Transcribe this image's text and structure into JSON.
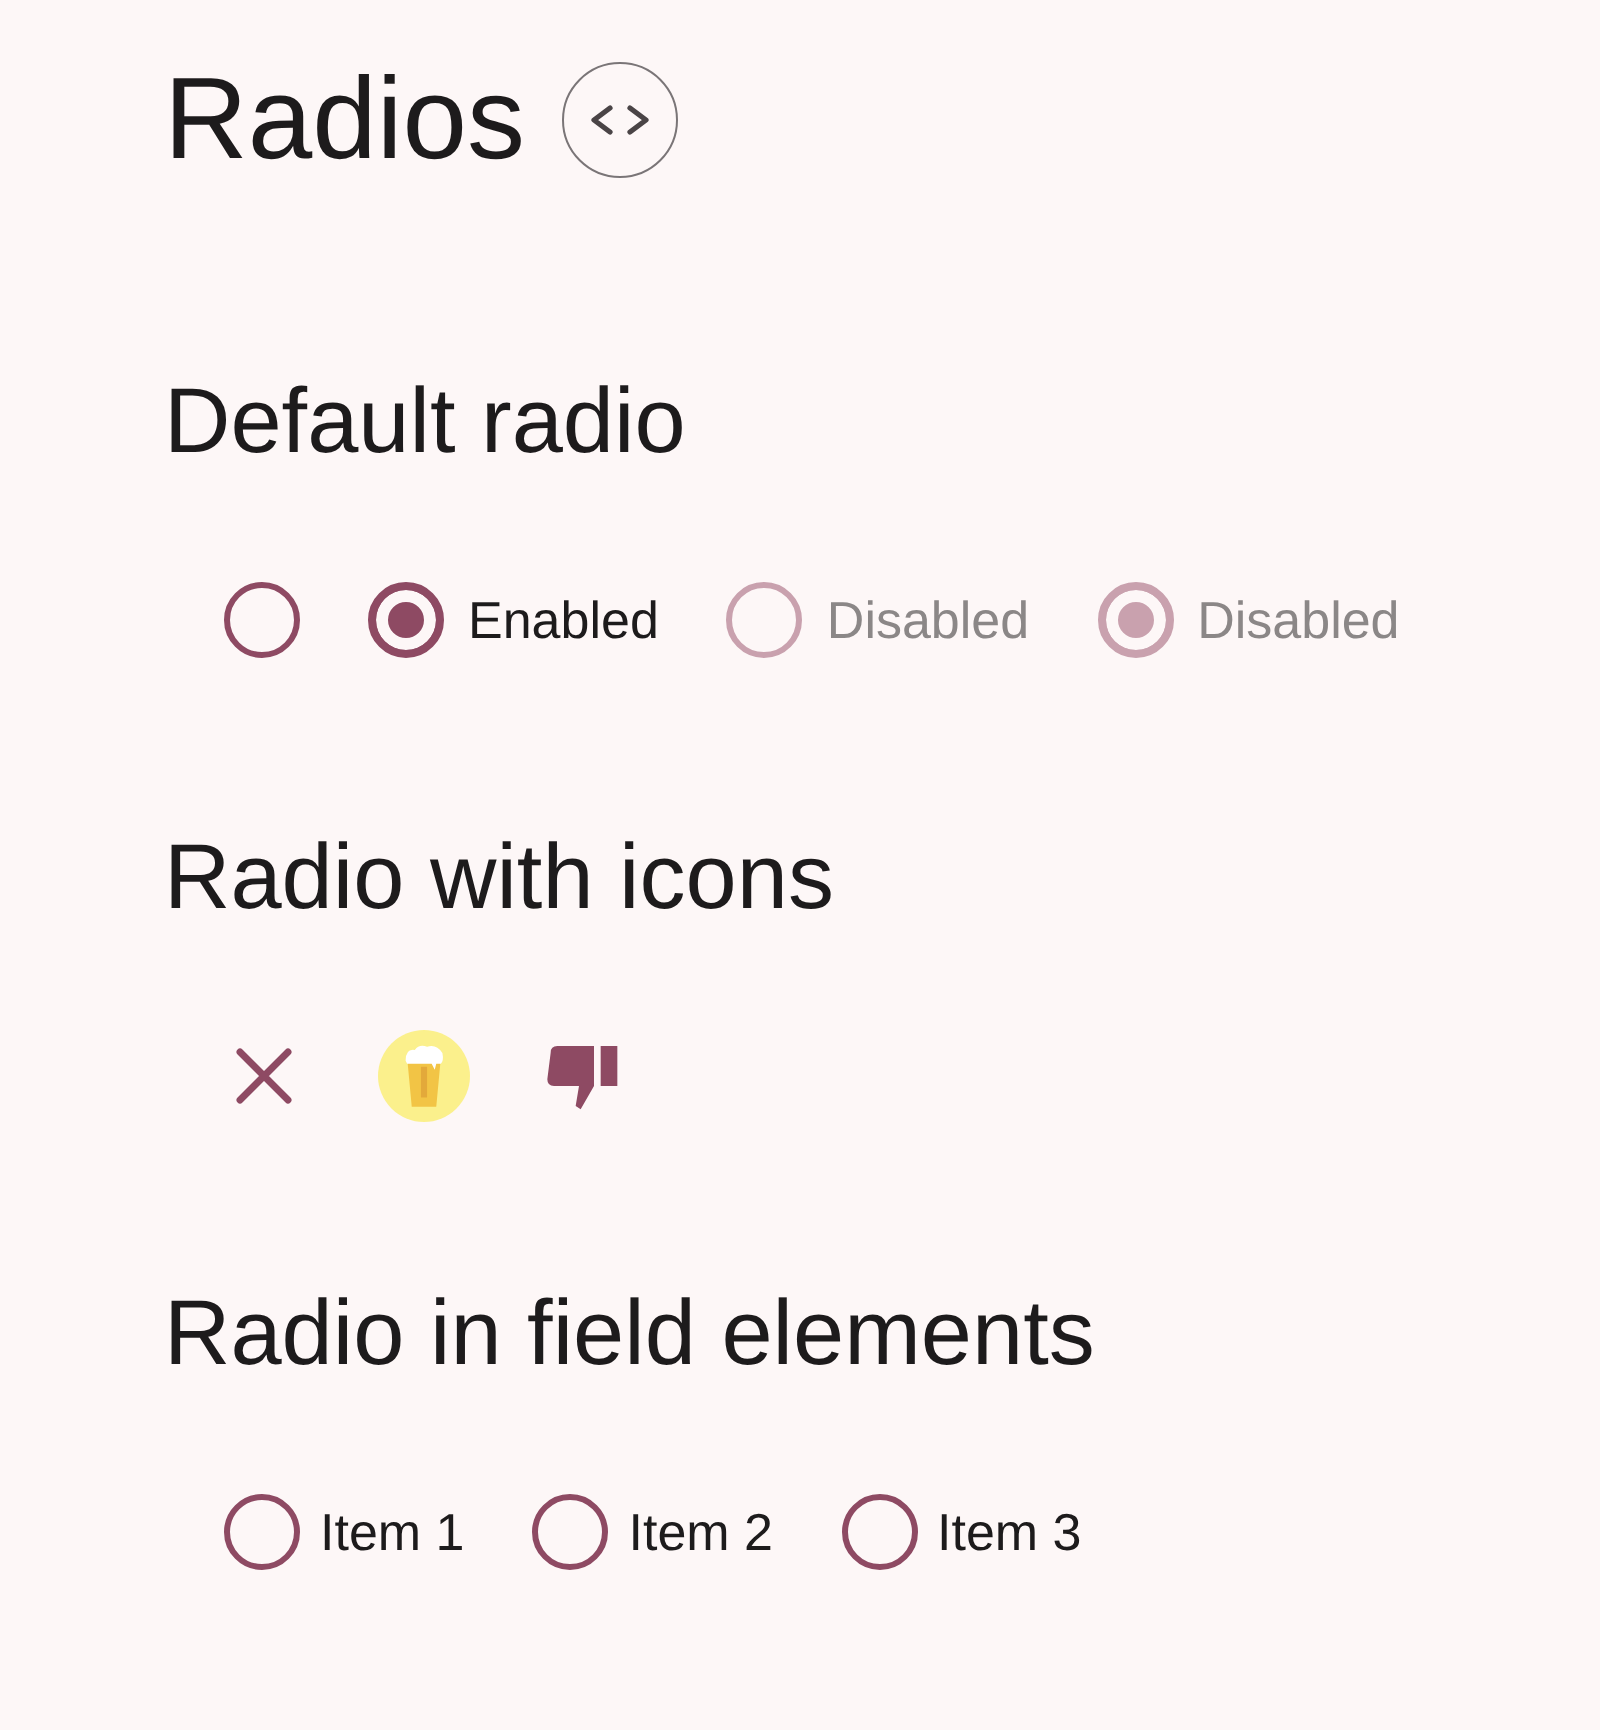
{
  "page": {
    "title": "Radios"
  },
  "sections": [
    {
      "heading": "Default radio",
      "kind": "plain",
      "options": [
        {
          "selected": false,
          "disabled": false
        },
        {
          "label": "Enabled",
          "selected": true,
          "disabled": false
        },
        {
          "label": "Disabled",
          "selected": false,
          "disabled": true
        },
        {
          "label": "Disabled",
          "selected": true,
          "disabled": true
        }
      ]
    },
    {
      "heading": "Radio with icons",
      "kind": "icon",
      "options": [
        {
          "selected": false
        },
        {
          "selected": true
        },
        {
          "selected": false
        }
      ]
    },
    {
      "heading": "Radio in field elements",
      "kind": "field",
      "options": [
        {
          "label": "Item 1",
          "selected": false
        },
        {
          "label": "Item 2",
          "selected": false
        },
        {
          "label": "Item 3",
          "selected": false
        }
      ]
    }
  ]
}
